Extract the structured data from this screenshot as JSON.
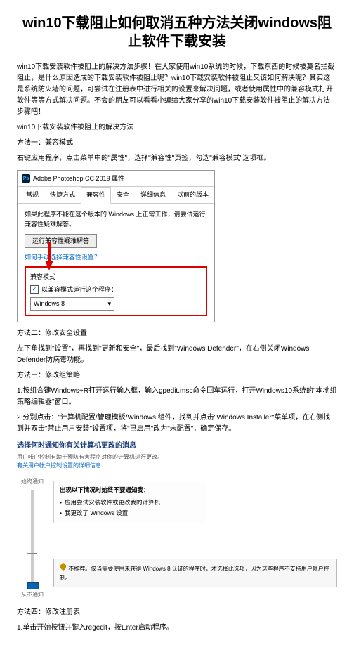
{
  "title": "win10下载阻止如何取消五种方法关闭windows阻止软件下载安装",
  "intro": "win10下载安装软件被阻止的解决方法步骤！在大家使用win10系统的时候，下载东西的时候被莫名拦截阻止，是什么原因造成的下载安装软件被阻止呢？win10下载安装软件被阻止又该如何解决呢？其实这是系统防火墙的问题，可尝试在注册表中进行相关的设置来解决问题，或者使用属性中的兼容模式打开软件等等方式解决问题。不会的朋友可以看看小编给大家分享的win10下载安装软件被阻止的解决方法步骤吧！",
  "subheading": "win10下载安装软件被阻止的解决方法",
  "method1": {
    "heading": "方法一：兼容模式",
    "text": "右键应用程序，点击菜单中的\"属性\"，选择\"兼容性\"页签，勾选\"兼容模式\"选项框。"
  },
  "dialog": {
    "title": "Adobe Photoshop CC 2019 属性",
    "tabs": [
      "常规",
      "快捷方式",
      "兼容性",
      "安全",
      "详细信息",
      "以前的版本"
    ],
    "body_text": "如果此程序不能在这个版本的 Windows 上正常工作，请尝试运行兼容性疑难解答。",
    "troubleshoot_btn": "运行兼容性疑难解答",
    "link": "如何手动选择兼容性设置？",
    "group_label": "兼容模式",
    "checkbox_label": "以兼容模式运行这个程序：",
    "dropdown_value": "Windows 8"
  },
  "method2": {
    "heading": "方法二：修改安全设置",
    "text": "左下角找到\"设置\"，再找到\"更新和安全\"，最后找到\"Windows Defender\"，在右侧关闭Windows Defender防病毒功能。"
  },
  "method3": {
    "heading": "方法三：修改组策略",
    "step1": "1.按组合键Windows+R打开运行输入框，输入gpedit.msc命令回车运行，打开Windows10系统的\"本地组策略编辑器\"窗口。",
    "step2": "2.分别点击：\"计算机配置/管理模板/Windows 组件，找到并点击\"Windows Installer\"菜单项，在右侧找到并双击\"禁止用户安装\"设置项，将\"已启用\"改为\"未配置\"，确定保存。"
  },
  "security": {
    "title": "选择何时通知你有关计算机更改的消息",
    "desc": "用户帐户控制有助于预防有害程序对你的计算机进行更改。",
    "link": "有关用户帐户控制设置的详细信息",
    "top_label": "始终通知",
    "bottom_label": "从不通知",
    "box_title": "出现以下情况时始终不要通知我：",
    "bullet1": "应用尝试安装软件或更改我的计算机",
    "bullet2": "我更改了 Windows 设置"
  },
  "warning": "不推荐。仅当需要使用未获得 Windows 8 认证的程序时，才选择此选项，因为这些程序不支持用户帐户控制。",
  "method4": {
    "heading": "方法四：修改注册表",
    "step1": "1.单击开始按钮并键入regedit，按Enter启动程序。"
  }
}
